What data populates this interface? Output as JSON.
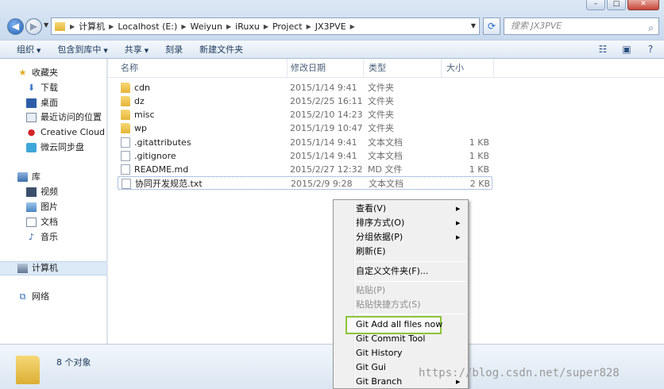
{
  "address": {
    "breadcrumbs": [
      "计算机",
      "Localhost (E:)",
      "Weiyun",
      "iRuxu",
      "Project",
      "JX3PVE"
    ],
    "search_placeholder": "搜索 JX3PVE"
  },
  "toolbar": {
    "items": [
      "组织",
      "包含到库中",
      "共享",
      "刻录",
      "新建文件夹"
    ]
  },
  "nav": {
    "favorites": {
      "label": "收藏夹",
      "items": [
        "下载",
        "桌面",
        "最近访问的位置",
        "Creative Cloud 文件",
        "微云同步盘"
      ]
    },
    "library": {
      "label": "库",
      "items": [
        "视频",
        "图片",
        "文档",
        "音乐"
      ]
    },
    "computer": "计算机",
    "network": "网络"
  },
  "columns": [
    "名称",
    "修改日期",
    "类型",
    "大小"
  ],
  "files": [
    {
      "name": "cdn",
      "date": "2015/1/14 9:41",
      "type": "文件夹",
      "size": "",
      "kind": "folder"
    },
    {
      "name": "dz",
      "date": "2015/2/25 16:11",
      "type": "文件夹",
      "size": "",
      "kind": "folder"
    },
    {
      "name": "misc",
      "date": "2015/2/10 14:23",
      "type": "文件夹",
      "size": "",
      "kind": "folder"
    },
    {
      "name": "wp",
      "date": "2015/1/19 10:47",
      "type": "文件夹",
      "size": "",
      "kind": "folder"
    },
    {
      "name": ".gitattributes",
      "date": "2015/1/14 9:41",
      "type": "文本文档",
      "size": "1 KB",
      "kind": "doc"
    },
    {
      "name": ".gitignore",
      "date": "2015/1/14 9:41",
      "type": "文本文档",
      "size": "1 KB",
      "kind": "doc"
    },
    {
      "name": "README.md",
      "date": "2015/2/27 12:32",
      "type": "MD 文件",
      "size": "1 KB",
      "kind": "doc"
    },
    {
      "name": "协同开发规范.txt",
      "date": "2015/2/9 9:28",
      "type": "文本文档",
      "size": "2 KB",
      "kind": "doc"
    }
  ],
  "details": {
    "count": "8 个对象"
  },
  "context_menu": {
    "items": [
      {
        "label": "查看(V)",
        "submenu": true,
        "enabled": true
      },
      {
        "label": "排序方式(O)",
        "submenu": true,
        "enabled": true
      },
      {
        "label": "分组依据(P)",
        "submenu": true,
        "enabled": true
      },
      {
        "label": "刷新(E)",
        "submenu": false,
        "enabled": true
      },
      {
        "label": "自定义文件夹(F)...",
        "submenu": false,
        "enabled": true
      },
      {
        "label": "粘贴(P)",
        "submenu": false,
        "enabled": false
      },
      {
        "label": "粘贴快捷方式(S)",
        "submenu": false,
        "enabled": false
      },
      {
        "label": "Git Add all files now",
        "submenu": false,
        "enabled": true
      },
      {
        "label": "Git Commit Tool",
        "submenu": false,
        "enabled": true
      },
      {
        "label": "Git History",
        "submenu": false,
        "enabled": true
      },
      {
        "label": "Git Gui",
        "submenu": false,
        "enabled": true
      },
      {
        "label": "Git Branch",
        "submenu": true,
        "enabled": true
      }
    ],
    "highlight_color": "#8cc43a"
  },
  "watermark": "https://blog.csdn.net/super828"
}
